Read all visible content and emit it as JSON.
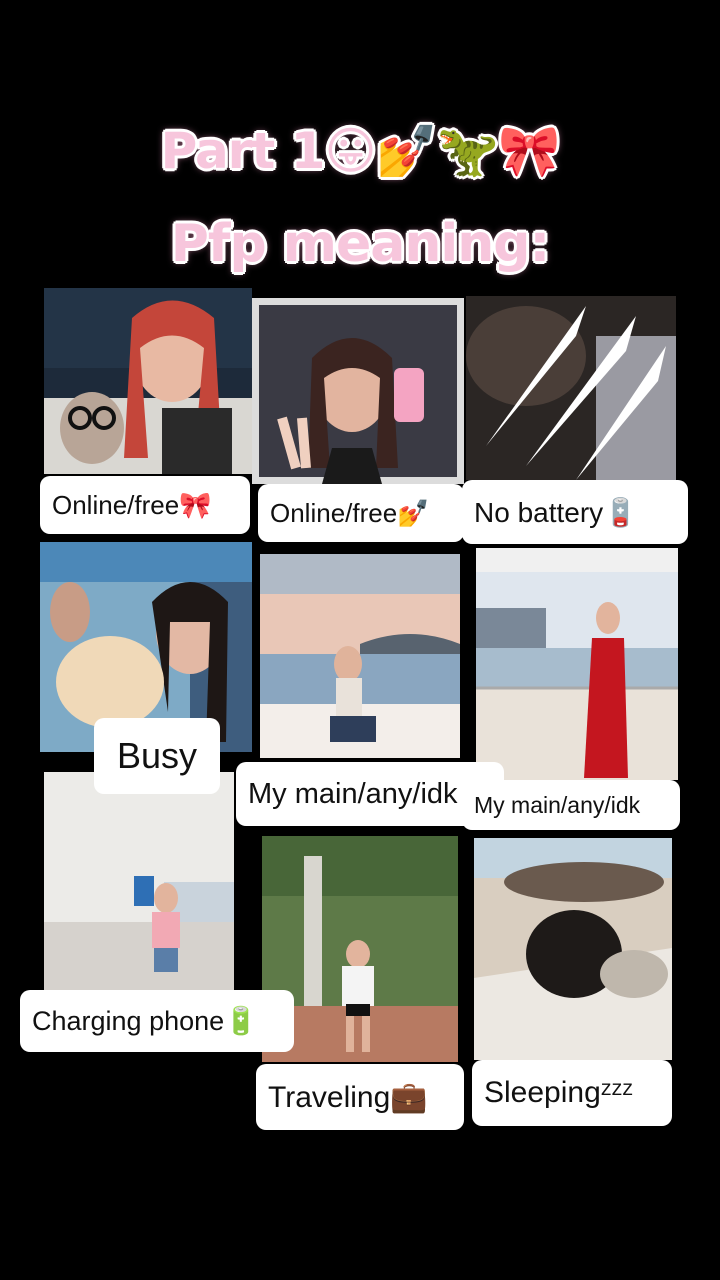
{
  "title_line1": "Part 1😛💅🦖🎀",
  "title_line2": "Pfp meaning:",
  "tiles": [
    {
      "label": "Online/free🎀"
    },
    {
      "label": "Online/free💅"
    },
    {
      "label": "No battery🪫"
    },
    {
      "label": "Busy"
    },
    {
      "label": "My main/any/idk"
    },
    {
      "label": "My main/any/idk"
    },
    {
      "label": "Charging phone🔋"
    },
    {
      "label": "Traveling💼"
    },
    {
      "label": "Sleepingᶻᶻᶻ"
    }
  ]
}
